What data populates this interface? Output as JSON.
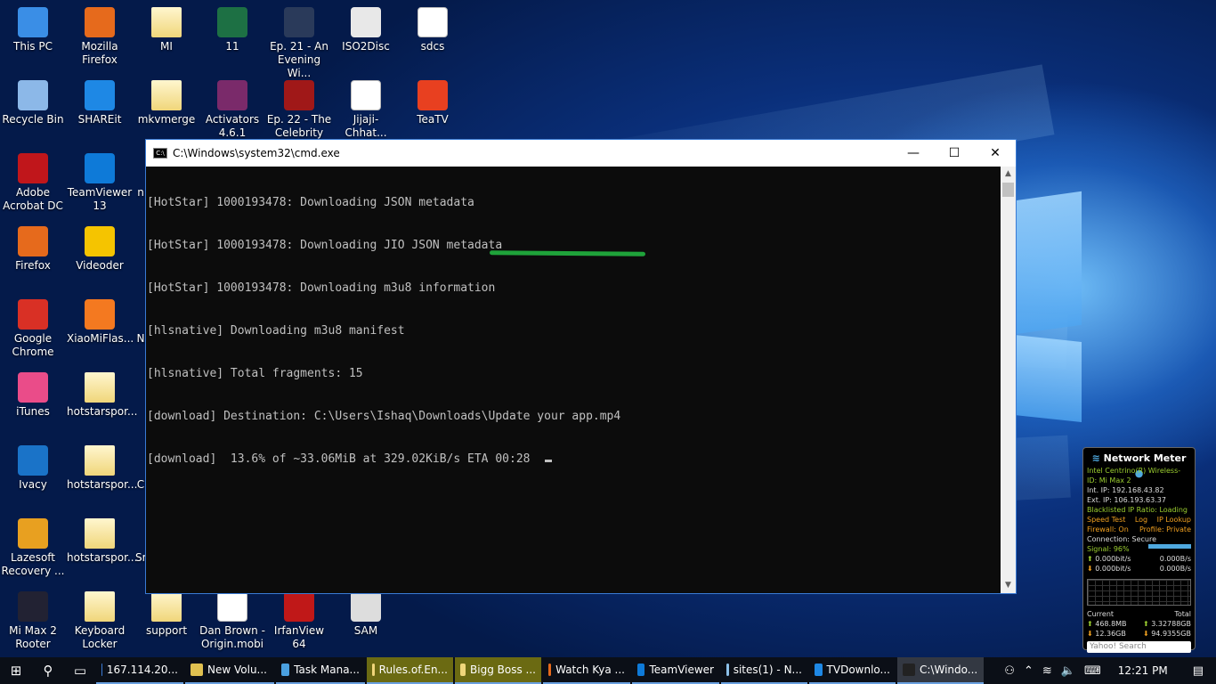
{
  "desktop_icons": [
    {
      "label": "This PC",
      "icon": "computer-icon",
      "color": "#3a8ee6"
    },
    {
      "label": "Mozilla Firefox",
      "icon": "firefox-icon",
      "color": "#e66a1c"
    },
    {
      "label": "MI",
      "icon": "folder-icon",
      "color": "#f0d67a"
    },
    {
      "label": "11",
      "icon": "excel-icon",
      "color": "#1d7044"
    },
    {
      "label": "Ep. 21 - An Evening Wi...",
      "icon": "video-icon",
      "color": "#2a3a5a"
    },
    {
      "label": "ISO2Disc",
      "icon": "disc-icon",
      "color": "#e8e8e8"
    },
    {
      "label": "sdcs",
      "icon": "document-icon",
      "color": "#ffffff"
    },
    {
      "label": "Recycle Bin",
      "icon": "recycle-bin-icon",
      "color": "#8cb8e8"
    },
    {
      "label": "SHAREit",
      "icon": "shareit-icon",
      "color": "#1e88e5"
    },
    {
      "label": "mkvmerge",
      "icon": "folder-icon",
      "color": "#f0d67a"
    },
    {
      "label": "Activators 4.6.1",
      "icon": "winrar-icon",
      "color": "#7a2a6a"
    },
    {
      "label": "Ep. 22 - The Celebrity S...",
      "icon": "video-icon",
      "color": "#a01818"
    },
    {
      "label": "Jijaji-Chhat...",
      "icon": "document-icon",
      "color": "#ffffff"
    },
    {
      "label": "TeaTV",
      "icon": "teatv-icon",
      "color": "#e84020"
    },
    {
      "label": "Adobe Acrobat DC",
      "icon": "acrobat-icon",
      "color": "#c0161b"
    },
    {
      "label": "TeamViewer 13",
      "icon": "teamviewer-icon",
      "color": "#0e7ad8"
    },
    {
      "label": "n",
      "icon": "partial-icon",
      "color": "#1e3a8a"
    },
    {
      "label": "Firefox",
      "icon": "firefox-icon",
      "color": "#e66a1c"
    },
    {
      "label": "Videoder",
      "icon": "videoder-icon",
      "color": "#f5c400"
    },
    {
      "label": "Google Chrome",
      "icon": "chrome-icon",
      "color": "#d93025"
    },
    {
      "label": "XiaoMiFlas...",
      "icon": "mi-icon",
      "color": "#f47920"
    },
    {
      "label": "N",
      "icon": "partial-icon",
      "color": "#1e3a8a"
    },
    {
      "label": "iTunes",
      "icon": "itunes-icon",
      "color": "#ea4c89"
    },
    {
      "label": "hotstarspor...",
      "icon": "folder-icon",
      "color": "#f0d67a"
    },
    {
      "label": "Ivacy",
      "icon": "ivacy-icon",
      "color": "#1a73c8"
    },
    {
      "label": "hotstarspor...",
      "icon": "folder-icon",
      "color": "#f0d67a"
    },
    {
      "label": "C",
      "icon": "partial-icon",
      "color": "#1e3a8a"
    },
    {
      "label": "Lazesoft Recovery ...",
      "icon": "lazesoft-icon",
      "color": "#e8a020"
    },
    {
      "label": "hotstarspor...",
      "icon": "folder-icon",
      "color": "#f0d67a"
    },
    {
      "label": "Sr",
      "icon": "partial-icon",
      "color": "#1e3a8a"
    },
    {
      "label": "Mi Max 2 Rooter",
      "icon": "phone-icon",
      "color": "#222233"
    },
    {
      "label": "Keyboard Locker",
      "icon": "folder-icon",
      "color": "#f0d67a"
    },
    {
      "label": "support",
      "icon": "archive-icon",
      "color": "#f0d67a"
    },
    {
      "label": "Dan Brown - Origin.mobi",
      "icon": "document-icon",
      "color": "#ffffff"
    },
    {
      "label": "IrfanView 64",
      "icon": "irfanview-icon",
      "color": "#c01818"
    },
    {
      "label": "SAM",
      "icon": "sam-icon",
      "color": "#dddddd"
    }
  ],
  "cmd": {
    "title": "C:\\Windows\\system32\\cmd.exe",
    "app_icon_text": "C:\\",
    "minimize": "—",
    "maximize": "☐",
    "close": "✕",
    "lines": [
      "[HotStar] 1000193478: Downloading JSON metadata",
      "[HotStar] 1000193478: Downloading JIO JSON metadata",
      "[HotStar] 1000193478: Downloading m3u8 information",
      "[hlsnative] Downloading m3u8 manifest",
      "[hlsnative] Total fragments: 15",
      "[download] Destination: C:\\Users\\Ishaq\\Downloads\\Update your app.mp4",
      "[download]  13.6% of ~33.06MiB at 329.02KiB/s ETA 00:28"
    ]
  },
  "network_meter": {
    "title": "Network Meter",
    "adapter": "Intel Centrino(R) Wireless-",
    "id": "ID: Mi Max 2",
    "int_ip": "Int. IP: 192.168.43.82",
    "ext_ip": "Ext. IP: 106.193.63.37",
    "blacklist": "Blacklisted IP Ratio: Loading",
    "speed_test": "Speed Test",
    "log": "Log",
    "ip_lookup": "IP Lookup",
    "firewall": "Firewall: On",
    "profile": "Profile: Private",
    "connection": "Connection: Secure",
    "signal": "Signal: 96%",
    "up_rate": "0.000bit/s",
    "up_bytes": "0.000B/s",
    "down_rate": "0.000bit/s",
    "down_bytes": "0.000B/s",
    "current_label": "Current",
    "total_label": "Total",
    "cur_up": "468.8MB",
    "tot_up": "3.32788GB",
    "cur_down": "12.36GB",
    "tot_down": "94.9355GB",
    "search": "Yahoo! Search"
  },
  "taskbar": {
    "items": [
      {
        "label": "167.114.20...",
        "color": "#3a7bd5",
        "style": ""
      },
      {
        "label": "New Volu...",
        "color": "#e0c050",
        "style": ""
      },
      {
        "label": "Task Mana...",
        "color": "#4aa0e0",
        "style": ""
      },
      {
        "label": "Rules.of.En...",
        "color": "#f0d67a",
        "style": "hl"
      },
      {
        "label": "Bigg Boss ...",
        "color": "#f0d67a",
        "style": "hl"
      },
      {
        "label": "Watch Kya ...",
        "color": "#e66a1c",
        "style": ""
      },
      {
        "label": "TeamViewer",
        "color": "#0e7ad8",
        "style": ""
      },
      {
        "label": "sites(1) - N...",
        "color": "#8cc0e8",
        "style": ""
      },
      {
        "label": "TVDownlo...",
        "color": "#1e88e5",
        "style": ""
      },
      {
        "label": "C:\\Windo...",
        "color": "#222",
        "style": "active"
      }
    ],
    "time": "12:21 PM"
  }
}
